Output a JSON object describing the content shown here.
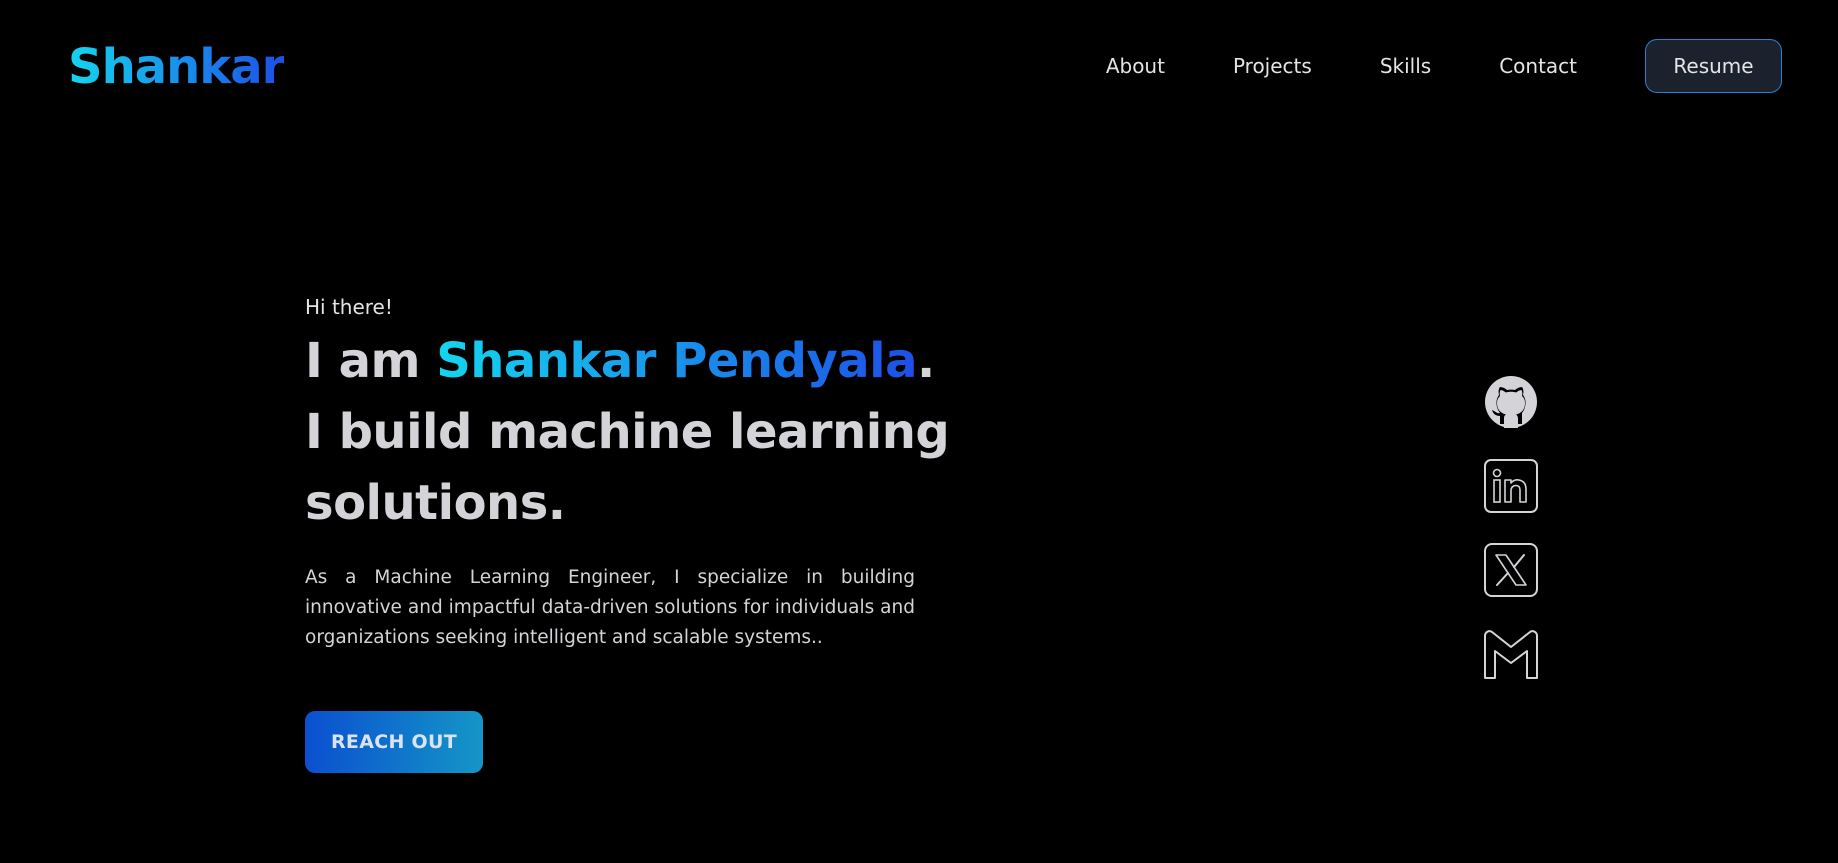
{
  "header": {
    "logo": "Shankar",
    "nav": [
      {
        "label": "About"
      },
      {
        "label": "Projects"
      },
      {
        "label": "Skills"
      },
      {
        "label": "Contact"
      }
    ],
    "resume_label": "Resume"
  },
  "hero": {
    "greeting": "Hi there!",
    "intro_prefix": "I am ",
    "name_first": "Shankar",
    "name_last": "Pendyala",
    "intro_suffix": ".",
    "tagline_line1": "I build machine learning",
    "tagline_line2": "solutions.",
    "description": "As a Machine Learning Engineer, I specialize in building innovative and impactful data-driven solutions for individuals and organizations seeking intelligent and scalable systems..",
    "cta_label": "REACH OUT"
  },
  "socials": [
    {
      "icon": "github-icon"
    },
    {
      "icon": "linkedin-icon"
    },
    {
      "icon": "x-twitter-icon"
    },
    {
      "icon": "gmail-icon"
    }
  ],
  "colors": {
    "background": "#000000",
    "gradient_start": "#14d6ee",
    "gradient_end": "#1d4fe8",
    "text": "#d4d4d8",
    "resume_border": "#2f7fd0",
    "resume_bg": "#1c222d"
  }
}
